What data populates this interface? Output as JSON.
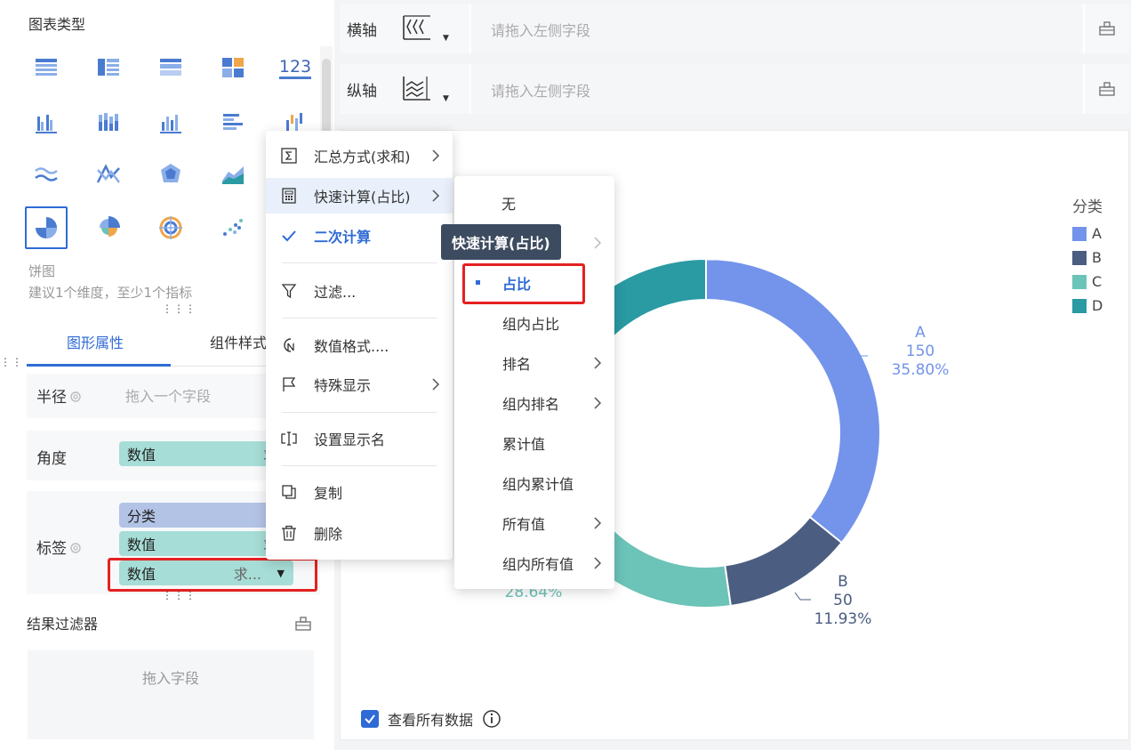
{
  "left_panel": {
    "chart_types_title": "图表类型",
    "number_chart_label": "123",
    "selected_chart_name": "饼图",
    "selected_chart_hint": "建议1个维度，至少1个指标",
    "tabs": [
      {
        "label": "图形属性"
      },
      {
        "label": "组件样式"
      }
    ],
    "properties": {
      "radius": {
        "label": "半径",
        "placeholder": "拖入一个字段"
      },
      "angle": {
        "label": "角度",
        "pill": {
          "field": "数值",
          "agg": "求和"
        }
      },
      "label": {
        "label": "标签",
        "pills": [
          {
            "field": "分类",
            "agg": ""
          },
          {
            "field": "数值",
            "agg": "求和"
          },
          {
            "field": "数值",
            "agg": "求..."
          }
        ]
      }
    },
    "result_filter": {
      "title": "结果过滤器",
      "placeholder": "拖入字段"
    }
  },
  "axes": {
    "x": {
      "label": "横轴",
      "placeholder": "请拖入左侧字段"
    },
    "y": {
      "label": "纵轴",
      "placeholder": "请拖入左侧字段"
    }
  },
  "context_menu": {
    "items": [
      {
        "label": "汇总方式(求和)",
        "icon": "sigma-icon",
        "has_submenu": true
      },
      {
        "label": "快速计算(占比)",
        "icon": "calculator-icon",
        "has_submenu": true
      },
      {
        "label": "二次计算",
        "icon": "check-icon",
        "checked": true
      },
      {
        "label": "过滤...",
        "icon": "filter-icon"
      },
      {
        "label": "数值格式....",
        "icon": "number-format-icon"
      },
      {
        "label": "特殊显示",
        "icon": "flag-icon",
        "has_submenu": true
      },
      {
        "label": "设置显示名",
        "icon": "rename-icon"
      },
      {
        "label": "复制",
        "icon": "copy-icon"
      },
      {
        "label": "删除",
        "icon": "trash-icon"
      }
    ]
  },
  "quick_calc_submenu": {
    "items": [
      {
        "label": "无"
      },
      {
        "label": "",
        "has_submenu": true
      },
      {
        "label": "占比",
        "selected": true
      },
      {
        "label": "组内占比"
      },
      {
        "label": "排名",
        "has_submenu": true
      },
      {
        "label": "组内排名",
        "has_submenu": true
      },
      {
        "label": "累计值"
      },
      {
        "label": "组内累计值"
      },
      {
        "label": "所有值",
        "has_submenu": true
      },
      {
        "label": "组内所有值",
        "has_submenu": true
      }
    ]
  },
  "tooltip": "快速计算(占比)",
  "chart_data": {
    "type": "pie",
    "legend_title": "分类",
    "legend_position": "right",
    "categories": [
      "A",
      "B",
      "C",
      "D"
    ],
    "values": [
      150,
      50,
      120,
      99
    ],
    "percent_labels": [
      "35.80%",
      "11.93%",
      "28.64%",
      "23.63%"
    ],
    "colors": [
      "#7394ea",
      "#4b5d80",
      "#6cc3b8",
      "#2a9aa3"
    ],
    "visible_labels": [
      {
        "name": "A",
        "value": "150",
        "percent": "35.80%"
      },
      {
        "name": "B",
        "value": "50",
        "percent": "11.93%"
      },
      {
        "name": "C",
        "value": "",
        "percent": "28.64%"
      }
    ]
  },
  "footer": {
    "view_all_data": "查看所有数据"
  }
}
